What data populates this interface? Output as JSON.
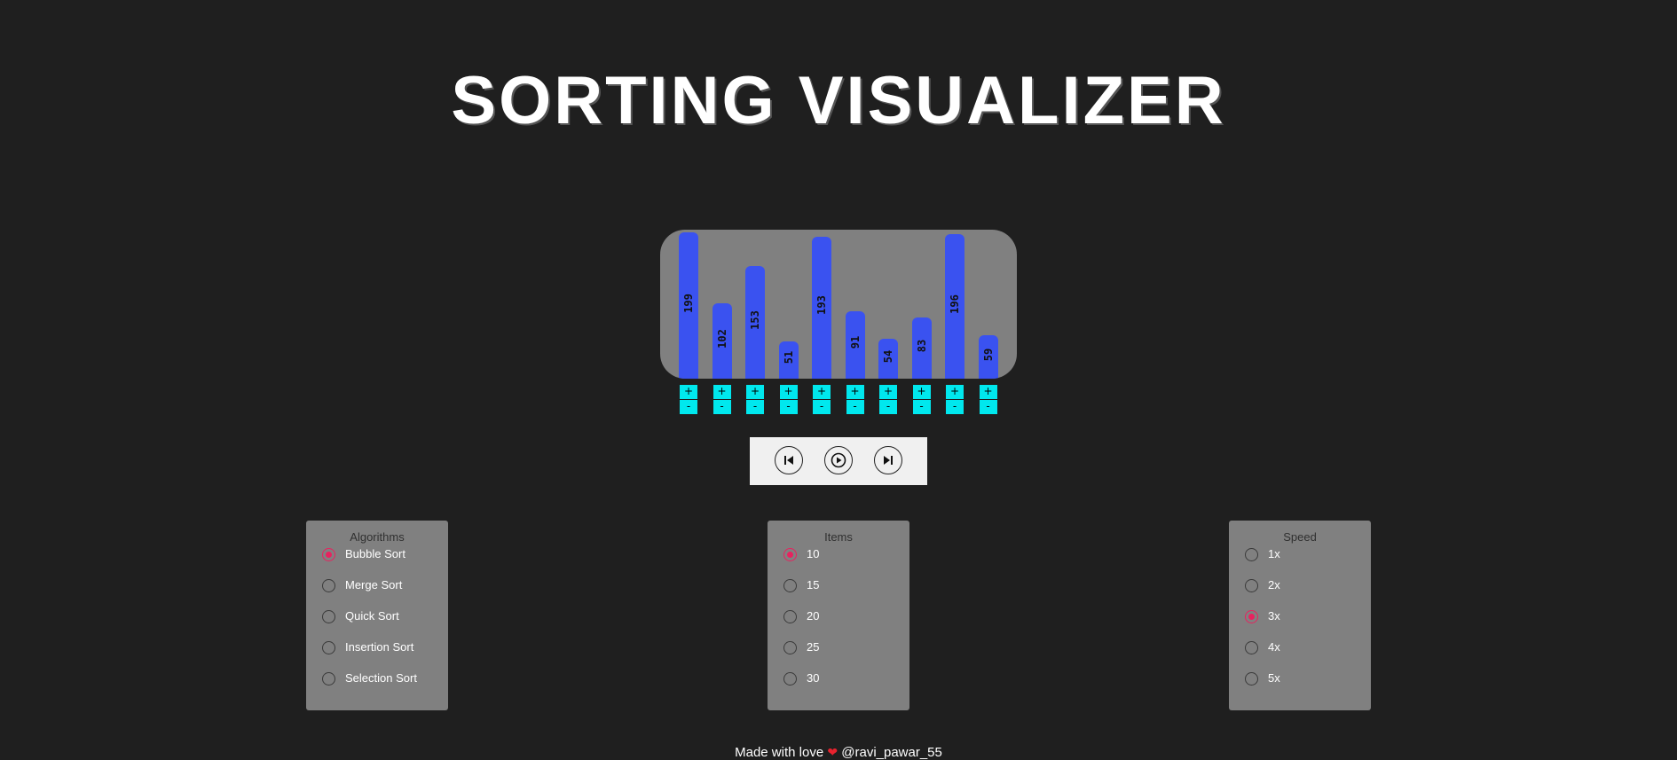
{
  "title": "SORTING VISUALIZER",
  "chart_data": {
    "type": "bar",
    "values": [
      199,
      102,
      153,
      51,
      193,
      91,
      54,
      83,
      196,
      59
    ],
    "labels": [
      "199",
      "102",
      "153",
      "51",
      "193",
      "91",
      "54",
      "83",
      "196",
      "59"
    ],
    "max": 200
  },
  "controls": {
    "plus": "+",
    "minus": "-"
  },
  "panels": {
    "algorithms": {
      "title": "Algorithms",
      "options": [
        "Bubble Sort",
        "Merge Sort",
        "Quick Sort",
        "Insertion Sort",
        "Selection Sort"
      ],
      "selected": 0
    },
    "items": {
      "title": "Items",
      "options": [
        "10",
        "15",
        "20",
        "25",
        "30"
      ],
      "selected": 0
    },
    "speed": {
      "title": "Speed",
      "options": [
        "1x",
        "2x",
        "3x",
        "4x",
        "5x"
      ],
      "selected": 2
    }
  },
  "footer": {
    "text": "Made with love",
    "heart": "❤",
    "handle": "@ravi_pawar_55"
  },
  "colors": {
    "bar": "#3a52f0",
    "control": "#00e8ee",
    "radio_selected": "#e8225f"
  },
  "icons": {
    "prev": "skip-previous-icon",
    "play": "play-icon",
    "next": "skip-next-icon"
  }
}
